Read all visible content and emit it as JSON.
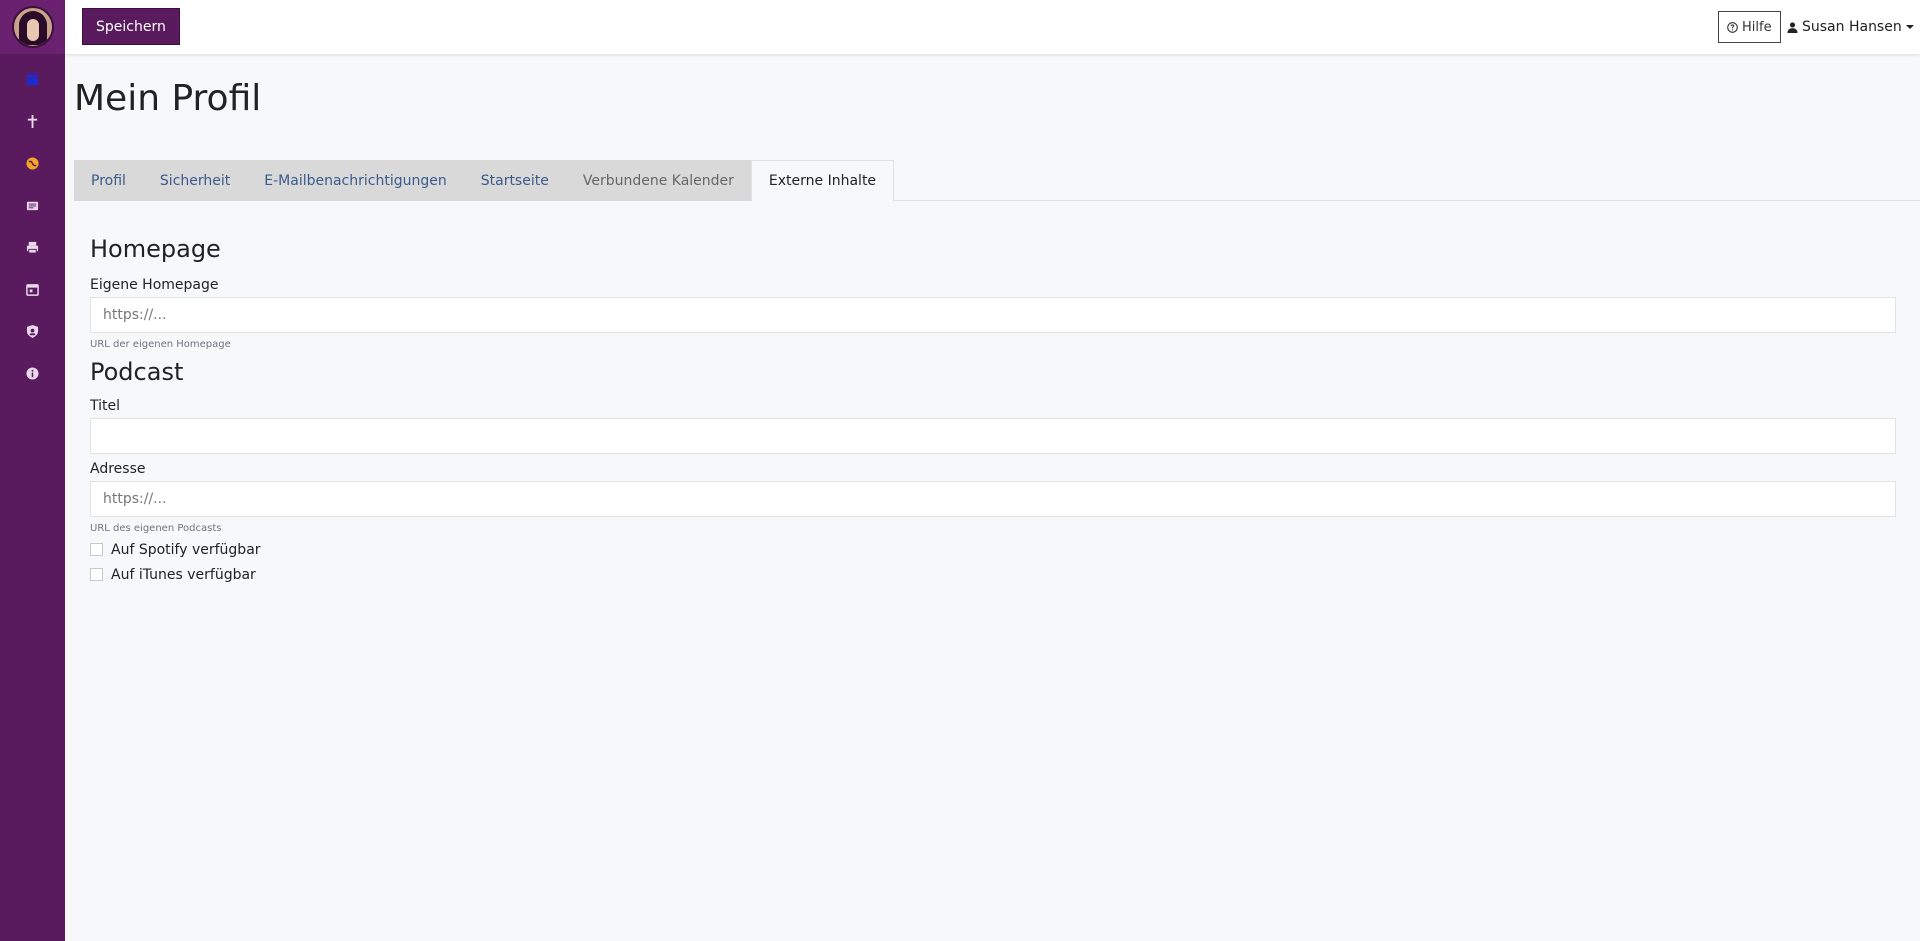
{
  "toolbar": {
    "save_label": "Speichern"
  },
  "header": {
    "help_label": "Hilfe",
    "user_name": "Susan Hansen"
  },
  "page": {
    "title": "Mein Profil"
  },
  "sidebar": {
    "icons": [
      {
        "name": "calendar-icon",
        "color": "#1a2bd6"
      },
      {
        "name": "cross-icon",
        "color": "#e8d8ea"
      },
      {
        "name": "globe-icon",
        "color": "#f5a623"
      },
      {
        "name": "newspaper-icon",
        "color": "#e8d8ea"
      },
      {
        "name": "printer-icon",
        "color": "#e8d8ea"
      },
      {
        "name": "calendar-day-icon",
        "color": "#e8d8ea"
      },
      {
        "name": "user-shield-icon",
        "color": "#e8d8ea"
      },
      {
        "name": "info-icon",
        "color": "#e8d8ea"
      }
    ]
  },
  "tabs": [
    {
      "label": "Profil"
    },
    {
      "label": "Sicherheit"
    },
    {
      "label": "E-Mailbenachrichtigungen"
    },
    {
      "label": "Startseite"
    },
    {
      "label": "Verbundene Kalender"
    },
    {
      "label": "Externe Inhalte"
    }
  ],
  "homepage": {
    "heading": "Homepage",
    "label": "Eigene Homepage",
    "placeholder": "https://...",
    "help": "URL der eigenen Homepage"
  },
  "podcast": {
    "heading": "Podcast",
    "title_label": "Titel",
    "title_value": "",
    "address_label": "Adresse",
    "address_placeholder": "https://...",
    "address_help": "URL des eigenen Podcasts",
    "spotify_label": "Auf Spotify verfügbar",
    "itunes_label": "Auf iTunes verfügbar"
  },
  "colors": {
    "brand": "#5a1a5e",
    "accent_icon": "#f5a623"
  }
}
